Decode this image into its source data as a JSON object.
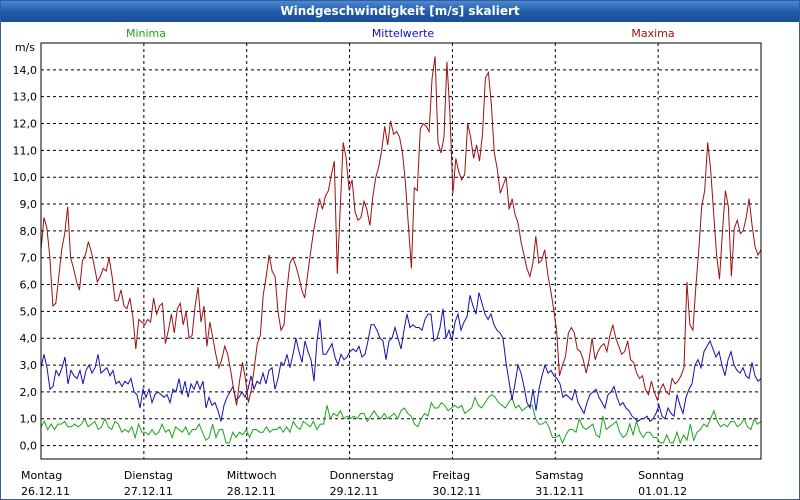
{
  "window": {
    "title": "Windgeschwindigkeit [m/s] skaliert"
  },
  "colors": {
    "minima": "#1aa51a",
    "mittelwerte": "#1010b0",
    "maxima": "#9b1111"
  },
  "chart_data": {
    "type": "line",
    "title": "Windgeschwindigkeit [m/s] skaliert",
    "ylabel": "m/s",
    "ylim": [
      -0.5,
      15.0
    ],
    "yticks": [
      "0,0",
      "1,0",
      "2,0",
      "3,0",
      "4,0",
      "5,0",
      "6,0",
      "7,0",
      "8,0",
      "9,0",
      "10,0",
      "11,0",
      "12,0",
      "13,0",
      "14,0"
    ],
    "ytick_values": [
      0,
      1,
      2,
      3,
      4,
      5,
      6,
      7,
      8,
      9,
      10,
      11,
      12,
      13,
      14
    ],
    "x_day_labels": [
      {
        "day": "Montag",
        "date": "26.12.11"
      },
      {
        "day": "Dienstag",
        "date": "27.12.11"
      },
      {
        "day": "Mittwoch",
        "date": "28.12.11"
      },
      {
        "day": "Donnerstag",
        "date": "29.12.11"
      },
      {
        "day": "Freitag",
        "date": "30.12.11"
      },
      {
        "day": "Samstag",
        "date": "31.12.11"
      },
      {
        "day": "Sonntag",
        "date": "01.01.12"
      }
    ],
    "x_range_days": [
      0,
      7
    ],
    "grid": true,
    "legend_placement": "top",
    "series": [
      {
        "name": "Minima",
        "values": [
          0.7,
          0.9,
          0.6,
          0.8,
          0.6,
          0.8,
          0.8,
          0.9,
          0.7,
          0.7,
          0.8,
          0.7,
          0.8,
          1.0,
          0.7,
          0.8,
          0.9,
          0.6,
          0.7,
          1.0,
          0.7,
          0.6,
          0.9,
          0.8,
          0.5,
          0.6,
          0.5,
          0.7,
          0.3,
          0.8,
          0.5,
          0.5,
          0.4,
          0.6,
          0.4,
          0.5,
          0.8,
          0.5,
          0.6,
          0.3,
          0.7,
          0.6,
          0.5,
          0.7,
          0.4,
          0.6,
          0.6,
          0.8,
          0.5,
          0.2,
          0.3,
          0.8,
          0.3,
          0.6,
          0.6,
          0.1,
          0.1,
          0.5,
          0.3,
          0.5,
          0.4,
          0.6,
          0.3,
          0.6,
          0.6,
          0.5,
          0.5,
          0.7,
          0.5,
          0.6,
          0.6,
          0.7,
          0.5,
          0.7,
          0.5,
          0.9,
          0.7,
          0.6,
          0.9,
          0.8,
          0.7,
          0.9,
          0.6,
          0.8,
          0.8,
          1.5,
          1.0,
          1.2,
          1.1,
          1.3,
          1.0,
          1.1,
          1.0,
          1.1,
          1.0,
          1.2,
          1.2,
          0.9,
          1.1,
          1.3,
          1.1,
          1.0,
          1.2,
          1.0,
          1.1,
          1.2,
          1.0,
          1.3,
          1.4,
          1.2,
          1.1,
          0.8,
          0.7,
          1.0,
          1.2,
          1.1,
          1.6,
          1.4,
          1.4,
          1.6,
          1.5,
          1.3,
          1.4,
          1.5,
          1.4,
          1.5,
          1.2,
          1.3,
          1.4,
          1.8,
          1.5,
          1.4,
          1.6,
          1.8,
          1.9,
          1.8,
          1.6,
          1.5,
          1.4,
          1.6,
          1.8,
          1.4,
          1.5,
          1.3,
          1.4,
          1.5,
          1.5,
          1.0,
          0.8,
          0.8,
          0.9,
          0.7,
          0.3,
          0.3,
          0.4,
          0.1,
          0.4,
          0.6,
          0.6,
          0.5,
          1.0,
          0.7,
          0.6,
          0.7,
          0.8,
          0.4,
          0.3,
          1.1,
          0.6,
          0.7,
          0.8,
          0.9,
          0.5,
          0.3,
          0.4,
          0.8,
          0.4,
          0.9,
          0.5,
          0.3,
          0.5,
          0.5,
          0.3,
          0.3,
          0.1,
          0.1,
          0.4,
          0.1,
          0.1,
          0.5,
          0.1,
          0.4,
          0.2,
          0.8,
          0.2,
          0.5,
          0.6,
          0.8,
          0.7,
          1.0,
          1.3,
          0.9,
          0.7,
          0.8,
          0.7,
          0.9,
          0.9,
          0.7,
          0.8,
          1.0,
          0.7,
          0.6,
          1.0,
          0.8,
          0.9
        ]
      },
      {
        "name": "Mittelwerte",
        "values": [
          2.9,
          3.4,
          2.9,
          2.1,
          2.2,
          2.8,
          2.6,
          2.9,
          3.3,
          2.3,
          2.8,
          2.6,
          2.5,
          2.8,
          2.3,
          2.8,
          3.0,
          2.7,
          2.9,
          3.4,
          2.7,
          2.8,
          2.9,
          2.6,
          2.8,
          2.3,
          2.4,
          2.2,
          2.4,
          2.3,
          2.5,
          2.0,
          1.9,
          1.4,
          2.1,
          1.8,
          2.1,
          1.6,
          1.9,
          2.0,
          1.9,
          1.8,
          1.9,
          1.6,
          2.1,
          2.0,
          2.5,
          1.9,
          2.4,
          1.8,
          2.3,
          2.1,
          2.4,
          2.1,
          2.4,
          1.4,
          1.8,
          1.5,
          1.6,
          1.3,
          0.9,
          1.5,
          1.8,
          2.0,
          2.2,
          1.7,
          1.8,
          2.0,
          1.8,
          2.1,
          2.6,
          2.1,
          2.4,
          2.3,
          2.7,
          2.3,
          2.8,
          2.9,
          2.1,
          2.5,
          3.1,
          3.0,
          3.4,
          2.9,
          3.4,
          4.0,
          3.5,
          3.1,
          3.9,
          3.5,
          3.2,
          2.4,
          3.9,
          4.7,
          3.4,
          3.4,
          3.6,
          3.8,
          3.3,
          3.0,
          3.4,
          3.2,
          3.3,
          3.5,
          3.6,
          3.5,
          3.7,
          3.3,
          3.4,
          3.9,
          4.5,
          4.5,
          4.3,
          4.0,
          3.9,
          3.2,
          3.9,
          4.0,
          4.4,
          4.0,
          3.6,
          4.3,
          4.9,
          4.4,
          4.5,
          4.4,
          4.4,
          4.3,
          4.7,
          4.9,
          4.9,
          3.9,
          4.0,
          4.4,
          5.1,
          4.0,
          4.3,
          3.9,
          4.6,
          4.9,
          4.3,
          4.6,
          4.8,
          5.6,
          5.2,
          4.9,
          5.7,
          5.3,
          4.9,
          4.7,
          4.9,
          4.5,
          4.3,
          4.2,
          4.0,
          3.1,
          2.4,
          1.7,
          2.3,
          3.0,
          2.7,
          2.2,
          1.6,
          1.4,
          2.1,
          1.3,
          2.1,
          2.6,
          3.0,
          2.7,
          2.8,
          2.6,
          2.5,
          2.3,
          1.8,
          1.9,
          1.8,
          1.7,
          2.1,
          1.6,
          1.4,
          1.2,
          1.6,
          1.9,
          2.0,
          2.1,
          1.8,
          1.6,
          1.4,
          1.9,
          2.0,
          2.2,
          1.8,
          1.5,
          1.6,
          1.4,
          1.3,
          1.1,
          1.0,
          0.9,
          1.0,
          1.0,
          1.1,
          0.9,
          1.0,
          1.2,
          1.5,
          1.1,
          1.0,
          1.4,
          1.2,
          1.1,
          1.9,
          1.5,
          1.2,
          1.8,
          2.1,
          2.3,
          3.0,
          3.2,
          2.9,
          3.5,
          3.7,
          3.9,
          3.6,
          3.3,
          3.5,
          3.0,
          2.6,
          3.2,
          3.5,
          3.0,
          2.8,
          2.7,
          2.9,
          2.6,
          2.5,
          3.1,
          2.6,
          2.4,
          2.5
        ]
      },
      {
        "name": "Maxima",
        "values": [
          7.3,
          8.5,
          8.1,
          7.0,
          5.2,
          5.3,
          6.3,
          7.3,
          7.9,
          8.9,
          7.0,
          6.6,
          6.1,
          5.8,
          6.9,
          7.1,
          7.6,
          7.2,
          6.7,
          6.1,
          6.3,
          6.6,
          6.5,
          7.0,
          6.3,
          5.4,
          5.4,
          5.8,
          5.2,
          5.1,
          5.5,
          4.8,
          3.6,
          4.7,
          4.6,
          4.5,
          4.7,
          4.6,
          5.5,
          4.9,
          5.2,
          5.3,
          3.8,
          4.3,
          4.9,
          4.2,
          5.1,
          5.3,
          4.5,
          5.0,
          4.0,
          4.1,
          5.2,
          5.9,
          4.6,
          5.2,
          3.7,
          4.6,
          4.0,
          3.4,
          2.9,
          3.2,
          3.7,
          3.4,
          2.8,
          2.1,
          1.5,
          2.4,
          3.1,
          2.5,
          1.6,
          2.1,
          2.9,
          3.8,
          4.1,
          5.6,
          6.3,
          7.1,
          6.5,
          6.3,
          5.0,
          4.3,
          4.5,
          5.8,
          6.8,
          7.0,
          6.7,
          6.3,
          5.8,
          5.5,
          6.4,
          7.2,
          8.0,
          8.6,
          9.2,
          8.8,
          9.3,
          9.5,
          10.1,
          10.6,
          6.4,
          8.9,
          11.3,
          10.7,
          9.5,
          9.9,
          8.7,
          8.4,
          8.5,
          9.1,
          8.8,
          8.2,
          9.3,
          10.0,
          10.4,
          11.0,
          11.9,
          11.2,
          12.1,
          11.6,
          11.7,
          11.5,
          10.9,
          9.8,
          8.2,
          6.6,
          9.6,
          9.5,
          11.8,
          12.0,
          11.9,
          11.7,
          13.7,
          14.5,
          11.3,
          10.9,
          11.5,
          14.3,
          12.4,
          9.4,
          10.7,
          10.2,
          9.9,
          10.1,
          12.0,
          11.5,
          10.7,
          11.2,
          10.6,
          11.6,
          13.7,
          13.9,
          12.7,
          10.9,
          10.3,
          9.4,
          9.7,
          10.0,
          8.8,
          9.2,
          8.6,
          8.3,
          7.6,
          7.1,
          6.6,
          6.3,
          6.8,
          7.8,
          6.8,
          6.9,
          7.3,
          6.4,
          5.8,
          5.1,
          4.3,
          2.6,
          3.0,
          3.3,
          4.2,
          4.4,
          4.2,
          3.6,
          3.5,
          3.2,
          2.7,
          3.2,
          4.0,
          3.2,
          3.5,
          3.7,
          3.8,
          3.5,
          4.1,
          4.5,
          4.0,
          3.7,
          3.4,
          3.5,
          3.9,
          3.2,
          3.1,
          2.7,
          2.5,
          2.6,
          2.1,
          1.9,
          2.4,
          2.0,
          1.7,
          2.1,
          2.3,
          2.0,
          1.9,
          2.5,
          2.3,
          2.4,
          2.6,
          2.9,
          6.1,
          4.5,
          4.3,
          5.9,
          7.3,
          8.9,
          9.5,
          11.3,
          10.3,
          8.7,
          7.1,
          6.2,
          8.0,
          9.5,
          8.9,
          6.3,
          8.1,
          8.4,
          7.9,
          8.0,
          8.5,
          9.2,
          8.2,
          7.4,
          7.1,
          7.3
        ]
      }
    ]
  }
}
